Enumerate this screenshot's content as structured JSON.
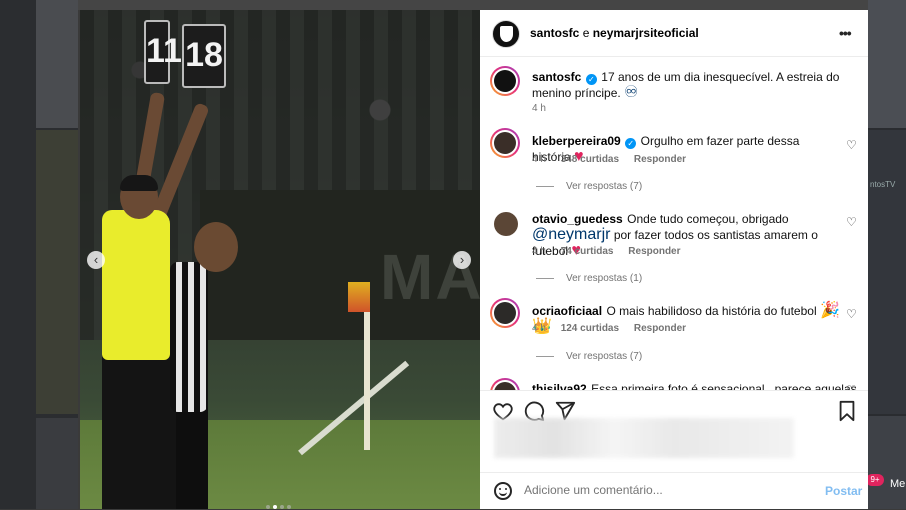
{
  "post": {
    "authors": "santosfc e neymarjrsiteoficial",
    "author1": "santosfc",
    "author_sep": " e ",
    "author2": "neymarjrsiteoficial",
    "caption_user": "santosfc",
    "caption": "17 anos de um dia inesquecível. A estreia do menino príncipe. ",
    "caption_emoji": "♾",
    "caption_time": "4 h"
  },
  "media": {
    "board_left": "11",
    "board_right": "18",
    "banner": "MAS",
    "prev_icon": "‹",
    "next_icon": "›",
    "dots": 4,
    "active_dot": 1
  },
  "comments": [
    {
      "user": "kleberpereira09",
      "verified": true,
      "text": "Orgulho em fazer parte dessa história ",
      "emoji": "♥",
      "time": "4 h",
      "likes": "348 curtidas",
      "reply": "Responder",
      "replies": "Ver respostas (7)"
    },
    {
      "user": "otavio_guedess",
      "verified": false,
      "text_before": "Onde tudo começou, obrigado ",
      "mention": "@neymarjr",
      "text_after": " por fazer todos os santistas amarem o futebol ",
      "emoji": "♥",
      "time": "4 h",
      "likes": "74 curtidas",
      "reply": "Responder",
      "replies": "Ver respostas (1)"
    },
    {
      "user": "ocriaoficiaal",
      "verified": false,
      "text": "O mais habilidoso da história do futebol ",
      "emoji": "🎉 👑",
      "time": "4 h",
      "likes": "124 curtidas",
      "reply": "Responder",
      "replies": "Ver respostas (7)"
    },
    {
      "user": "thisilva92",
      "text": "Essa primeira foto é sensacional , parece aquelas"
    }
  ],
  "comment_box": {
    "placeholder": "Adicione um comentário...",
    "post_label": "Postar"
  },
  "background": {
    "badge": "9+",
    "side_text1": "Me",
    "side_text2": "ntosTV"
  },
  "colors": {
    "accent": "#0095f6",
    "heart": "#e0245e",
    "referee_shirt": "#e9ec2c"
  }
}
